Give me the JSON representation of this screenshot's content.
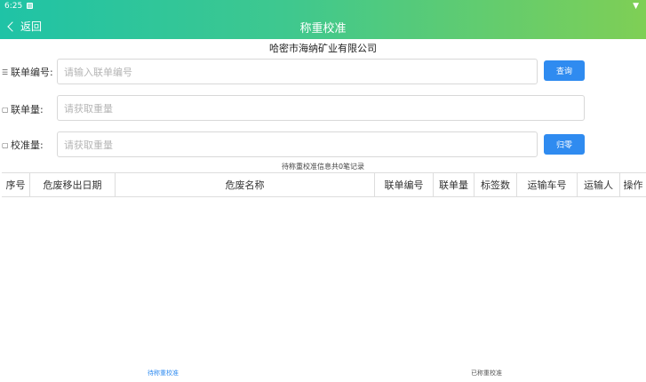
{
  "status": {
    "time": "6:25"
  },
  "header": {
    "back_label": "返回",
    "title": "称重校准"
  },
  "company": "哈密市海纳矿业有限公司",
  "form": {
    "manifest_no": {
      "label": "联单编号:",
      "placeholder": "请输入联单编号"
    },
    "manifest_weight": {
      "label": "联单量:",
      "placeholder": "请获取重量"
    },
    "calibration_weight": {
      "label": "校准量:",
      "placeholder": "请获取重量"
    },
    "query_button": "查询",
    "zero_button": "归零"
  },
  "records_summary": "待称重校准信息共0笔记录",
  "table": {
    "columns": [
      "序号",
      "危废移出日期",
      "危废名称",
      "联单编号",
      "联单量",
      "标签数",
      "运输车号",
      "运输人",
      "操作"
    ],
    "rows": []
  },
  "bottom_tabs": {
    "pending": "待称重校准",
    "done": "已称重校准"
  },
  "colors": {
    "accent": "#2f8bf0",
    "header_start": "#1fc3a6",
    "header_end": "#7fcf55"
  }
}
